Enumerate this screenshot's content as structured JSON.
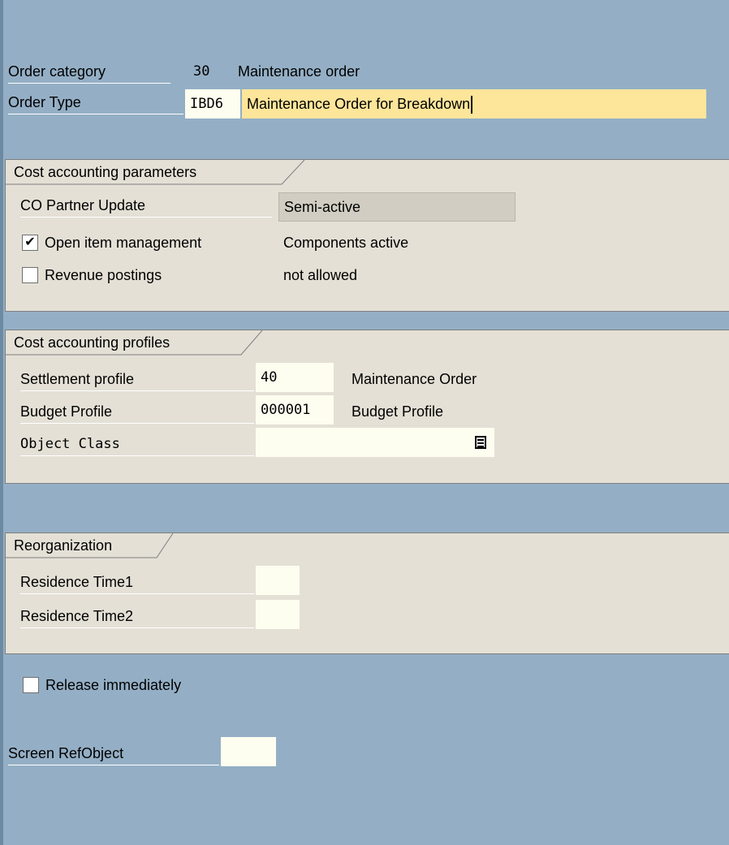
{
  "header": {
    "order_category": {
      "label": "Order category",
      "code": "30",
      "text": "Maintenance order"
    },
    "order_type": {
      "label": "Order Type",
      "code": "IBD6",
      "text": "Maintenance Order for Breakdown"
    }
  },
  "cost_params": {
    "title": "Cost accounting parameters",
    "co_partner_label": "CO Partner Update",
    "co_partner_value": "Semi-active",
    "open_item_label": "Open item management",
    "open_item_checked": true,
    "open_item_value": "Components active",
    "revenue_label": "Revenue postings",
    "revenue_checked": false,
    "revenue_value": "not allowed"
  },
  "cost_profiles": {
    "title": "Cost accounting profiles",
    "settlement_label": "Settlement profile",
    "settlement_value": "40",
    "settlement_desc": "Maintenance Order",
    "budget_label": "Budget Profile",
    "budget_value": "000001",
    "budget_desc": "Budget Profile",
    "object_class_label": "Object Class",
    "object_class_value": ""
  },
  "reorg": {
    "title": "Reorganization",
    "res1_label": "Residence Time1",
    "res1_value": "",
    "res2_label": "Residence Time2",
    "res2_value": ""
  },
  "release": {
    "label": "Release immediately",
    "checked": false
  },
  "screen_ref": {
    "label": "Screen RefObject",
    "value": ""
  },
  "icons": {
    "checkmark": "✔",
    "f4_help": "value-help-icon"
  },
  "colors": {
    "background": "#94afc5",
    "group": "#e4e0d6",
    "input_yellow": "#fde59a",
    "input_white": "#fdfdf0"
  }
}
